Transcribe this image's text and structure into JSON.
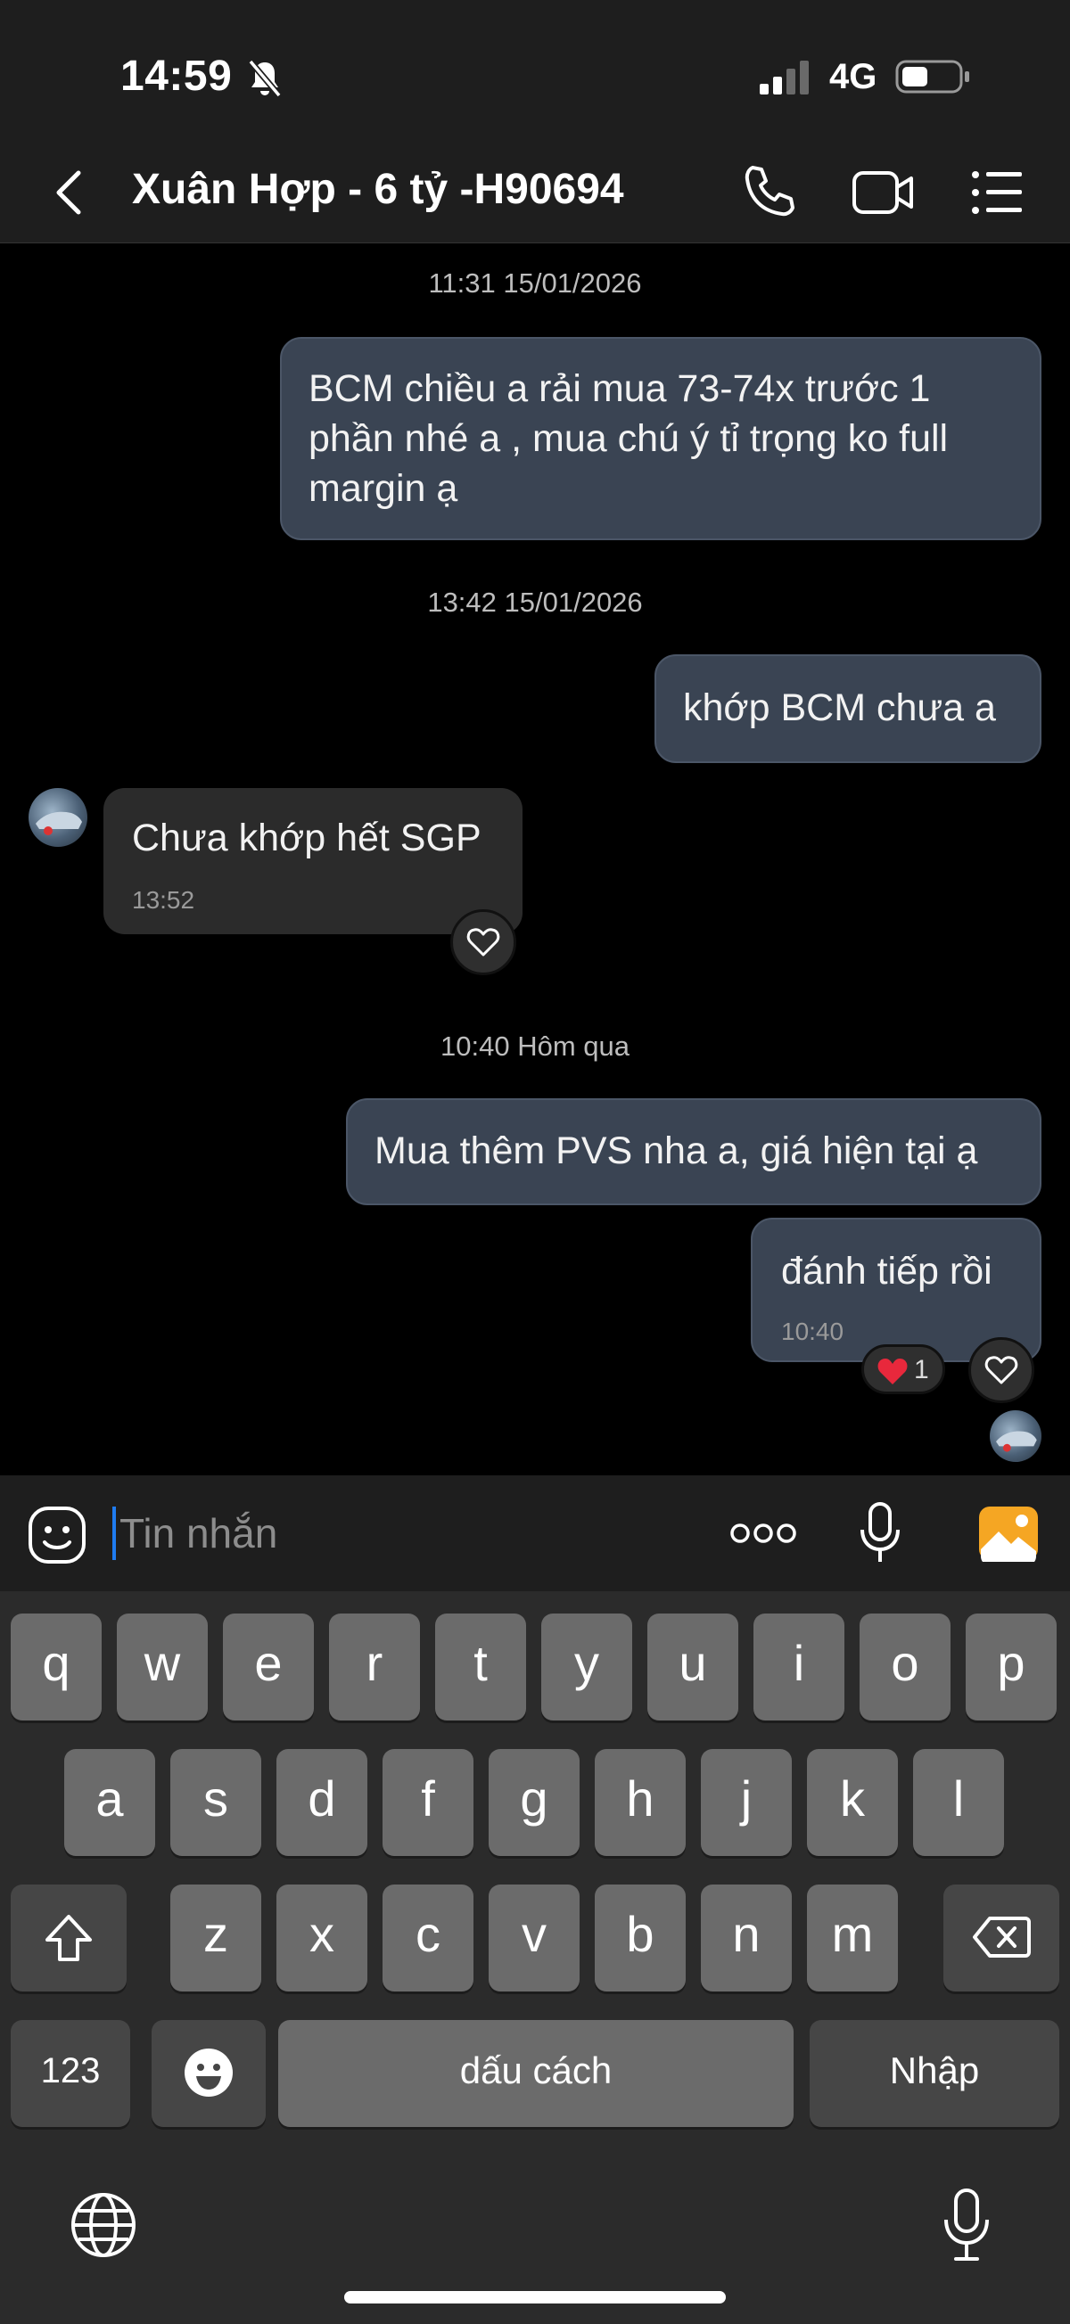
{
  "status": {
    "time": "14:59",
    "network": "4G"
  },
  "header": {
    "title": "Xuân Hợp - 6 tỷ -H90694"
  },
  "messages": {
    "ts1": "11:31 15/01/2026",
    "m1": [
      "BCM chiều a rải mua 73-74x trước 1",
      "phần nhé a , mua chú ý tỉ trọng ko full",
      "margin ạ"
    ],
    "ts2": "13:42 15/01/2026",
    "m2": "khớp BCM chưa a",
    "m3": "Chưa khớp hết SGP",
    "m3_time": "13:52",
    "ts3": "10:40 Hôm qua",
    "m4": "Mua thêm PVS nha a, giá hiện tại ạ",
    "m5": "đánh tiếp rồi",
    "m5_time": "10:40",
    "m5_reaction_count": "1"
  },
  "composer": {
    "placeholder": "Tin nhắn"
  },
  "keyboard": {
    "row1": [
      "q",
      "w",
      "e",
      "r",
      "t",
      "y",
      "u",
      "i",
      "o",
      "p"
    ],
    "row2": [
      "a",
      "s",
      "d",
      "f",
      "g",
      "h",
      "j",
      "k",
      "l"
    ],
    "row3": [
      "z",
      "x",
      "c",
      "v",
      "b",
      "n",
      "m"
    ],
    "numbers_label": "123",
    "space_label": "dấu cách",
    "enter_label": "Nhập"
  },
  "colors": {
    "accent": "#1f7cf0",
    "outgoing_bubble": "#3a4453",
    "incoming_bubble": "#2b2b2b",
    "gallery_icon": "#f5a623"
  },
  "icons": [
    "bell-off-icon",
    "signal-icon",
    "battery-icon",
    "back-icon",
    "phone-icon",
    "video-icon",
    "menu-icon",
    "heart-icon",
    "sticker-icon",
    "more-icon",
    "mic-icon",
    "gallery-icon",
    "shift-icon",
    "delete-icon",
    "emoji-icon",
    "globe-icon"
  ]
}
